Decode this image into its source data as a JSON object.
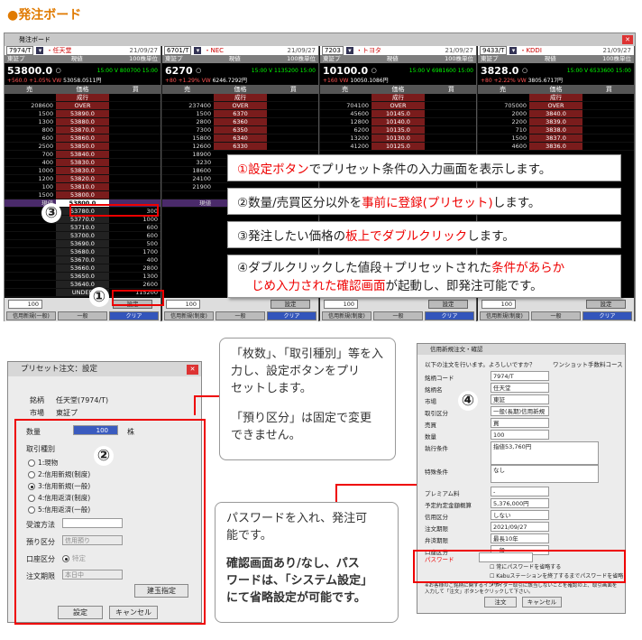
{
  "title": "●発注ボード",
  "board": {
    "window_title": "発注ボード",
    "panels": [
      {
        "code": "7974/T",
        "name": "・任天堂",
        "date": "21/09/27",
        "market": "東証プ",
        "mode": "現値",
        "unit": "100株単位",
        "price": "53800.0",
        "price_suffix": "○",
        "time": "15:00",
        "flag": "V",
        "vol": "800700",
        "t2": "15:00",
        "diff": "+560.0",
        "pct": "+1.05%",
        "vwap": "VW",
        "vwap_val": "53058.0511",
        "yen": "円",
        "cols": [
          "売",
          "価格",
          "買"
        ],
        "rows": [
          {
            "s": "",
            "p": "成行",
            "b": ""
          },
          {
            "s": "208600",
            "p": "OVER",
            "b": ""
          },
          {
            "s": "1500",
            "p": "53890.0",
            "b": ""
          },
          {
            "s": "1300",
            "p": "53880.0",
            "b": ""
          },
          {
            "s": "800",
            "p": "53870.0",
            "b": ""
          },
          {
            "s": "600",
            "p": "53860.0",
            "b": ""
          },
          {
            "s": "2500",
            "p": "53850.0",
            "b": ""
          },
          {
            "s": "700",
            "p": "53840.0",
            "b": ""
          },
          {
            "s": "400",
            "p": "53830.0",
            "b": ""
          },
          {
            "s": "1000",
            "p": "53830.0",
            "b": ""
          },
          {
            "s": "1200",
            "p": "53820.0",
            "b": ""
          },
          {
            "s": "100",
            "p": "53810.0",
            "b": ""
          },
          {
            "s": "1500",
            "p": "53800.0",
            "b": ""
          },
          {
            "s": "現値",
            "p": "53800.0",
            "b": "",
            "cur": true
          },
          {
            "s": "",
            "p": "53780.0",
            "b": "300"
          },
          {
            "s": "",
            "p": "53770.0",
            "b": "1000"
          },
          {
            "s": "",
            "p": "53710.0",
            "b": "600"
          },
          {
            "s": "",
            "p": "53700.0",
            "b": "600"
          },
          {
            "s": "",
            "p": "53690.0",
            "b": "500"
          },
          {
            "s": "",
            "p": "53680.0",
            "b": "1700"
          },
          {
            "s": "",
            "p": "53670.0",
            "b": "400"
          },
          {
            "s": "",
            "p": "53660.0",
            "b": "2800"
          },
          {
            "s": "",
            "p": "53650.0",
            "b": "1300"
          },
          {
            "s": "",
            "p": "53640.0",
            "b": "2600"
          },
          {
            "s": "",
            "p": "UNDER",
            "b": "115200"
          }
        ],
        "qty": "100",
        "set": "設定",
        "buttons": [
          "信用新規(一般)",
          "一般",
          "クリア"
        ]
      },
      {
        "code": "6701/T",
        "name": "・NEC",
        "date": "21/09/27",
        "market": "東証プ",
        "mode": "現値",
        "unit": "100株単位",
        "price": "6270",
        "price_suffix": "○",
        "time": "15:00",
        "flag": "V",
        "vol": "1135200",
        "t2": "15:00",
        "diff": "+80",
        "pct": "+1.29%",
        "vwap": "VW",
        "vwap_val": "6246.7292",
        "yen": "円",
        "cols": [
          "売",
          "価格",
          "買"
        ],
        "rows": [
          {
            "s": "",
            "p": "成行",
            "b": ""
          },
          {
            "s": "237400",
            "p": "OVER",
            "b": ""
          },
          {
            "s": "1500",
            "p": "6370",
            "b": ""
          },
          {
            "s": "2800",
            "p": "6360",
            "b": ""
          },
          {
            "s": "7300",
            "p": "6350",
            "b": ""
          },
          {
            "s": "15800",
            "p": "6340",
            "b": ""
          },
          {
            "s": "12600",
            "p": "6330",
            "b": ""
          },
          {
            "s": "18900",
            "p": "",
            "b": ""
          },
          {
            "s": "3230",
            "p": "",
            "b": ""
          },
          {
            "s": "18600",
            "p": "",
            "b": ""
          },
          {
            "s": "24100",
            "p": "",
            "b": ""
          },
          {
            "s": "21900",
            "p": "",
            "b": ""
          },
          {
            "s": "",
            "p": "",
            "b": ""
          },
          {
            "s": "現値",
            "p": "",
            "b": "",
            "cur": true
          }
        ],
        "qty": "100",
        "set": "設定",
        "buttons": [
          "信用新規(制度)",
          "一般",
          "クリア"
        ]
      },
      {
        "code": "7203",
        "name": "・トヨタ",
        "date": "21/09/27",
        "market": "東証プ",
        "mode": "現値",
        "unit": "100株単位",
        "price": "10100.0",
        "price_suffix": "○",
        "time": "15:00",
        "flag": "V",
        "vol": "6981600",
        "t2": "15:00",
        "diff": "+160",
        "pct": "",
        "vwap": "VW",
        "vwap_val": "10050.1086",
        "yen": "円",
        "cols": [
          "売",
          "価格",
          "買"
        ],
        "rows": [
          {
            "s": "",
            "p": "成行",
            "b": ""
          },
          {
            "s": "704100",
            "p": "OVER",
            "b": ""
          },
          {
            "s": "45600",
            "p": "10145.0",
            "b": ""
          },
          {
            "s": "12800",
            "p": "10140.0",
            "b": ""
          },
          {
            "s": "6200",
            "p": "10135.0",
            "b": ""
          },
          {
            "s": "13200",
            "p": "10130.0",
            "b": ""
          },
          {
            "s": "41200",
            "p": "10125.0",
            "b": ""
          }
        ],
        "qty": "100",
        "set": "設定",
        "buttons": [
          "信用新規(制度)",
          "一般",
          "クリア"
        ]
      },
      {
        "code": "9433/T",
        "name": "・KDDI",
        "date": "21/09/27",
        "market": "東証プ",
        "mode": "現値",
        "unit": "100株単位",
        "price": "3828.0",
        "price_suffix": "○",
        "time": "15:00",
        "flag": "V",
        "vol": "6533600",
        "t2": "15:00",
        "diff": "+80",
        "pct": "+2.22%",
        "vwap": "VW",
        "vwap_val": "3805.6717",
        "yen": "円",
        "cols": [
          "売",
          "価格",
          "買"
        ],
        "rows": [
          {
            "s": "",
            "p": "成行",
            "b": ""
          },
          {
            "s": "705000",
            "p": "OVER",
            "b": ""
          },
          {
            "s": "2000",
            "p": "3840.0",
            "b": ""
          },
          {
            "s": "2200",
            "p": "3839.0",
            "b": ""
          },
          {
            "s": "710",
            "p": "3838.0",
            "b": ""
          },
          {
            "s": "1500",
            "p": "3837.0",
            "b": ""
          },
          {
            "s": "4600",
            "p": "3836.0",
            "b": ""
          }
        ],
        "qty": "100",
        "set": "設定",
        "buttons": [
          "信用新規(制度)",
          "一般",
          "クリア"
        ]
      }
    ]
  },
  "callouts": [
    {
      "pre": "①",
      "red": "設定ボタン",
      "post": "でプリセット条件の入力画面を表示します。"
    },
    {
      "pre": "②数量/売買区分以外を",
      "red": "事前に登録(プリセット)",
      "post": "します。"
    },
    {
      "pre": "③発注したい価格の",
      "red": "板上でダブルクリック",
      "post": "します。"
    },
    {
      "pre": "④ダブルクリックした値段＋プリセットされた",
      "red": "条件があらか",
      "line2_red": "じめ入力された確認画面",
      "line2_post": "が起動し、即発注可能です。"
    }
  ],
  "nums": {
    "n1": "①",
    "n2": "②",
    "n3": "③",
    "n4": "④"
  },
  "preset": {
    "title": "プリセット注文：設定",
    "label_code": "銘柄",
    "code_val": "任天堂(7974/T)",
    "label_market": "市場",
    "market_val": "東証プ",
    "label_qty": "数量",
    "qty_val": "100",
    "qty_unit": "株",
    "label_type": "取引種別",
    "radios": [
      "1:現物",
      "2:信用新規(制度)",
      "3:信用新規(一般)",
      "4:信用返済(制度)",
      "5:信用返済(一般)"
    ],
    "label_method": "受渡方法",
    "label_deposit": "預り区分",
    "deposit_val": "信用預り",
    "label_account": "口座区分",
    "account_val": "特定",
    "label_period": "注文期限",
    "period_val": "本日中",
    "btn_settle": "建玉指定",
    "btn_set": "設定",
    "btn_cancel": "キャンセル"
  },
  "note1": {
    "l1": "「枚数」、「取引種別」等を入",
    "l2": "力し、設定ボタンをプリ",
    "l3": "セットします。",
    "l4": "「預り区分」は固定で変更",
    "l5": "できません。"
  },
  "note2": {
    "l1": "パスワードを入れ、発注可",
    "l2": "能です。",
    "l3": "確認画面あり/なし、パス",
    "l4": "ワードは、「システム設定」",
    "l5": "にて省略設定が可能です。"
  },
  "confirm": {
    "title": "信用新規注文・確認",
    "msg": "以下の注文を行います。よろしいですか？",
    "brand": "ワンショット手数料コース",
    "fields": [
      {
        "k": "銘柄コード",
        "v": "7974/T"
      },
      {
        "k": "銘柄名",
        "v": "任天堂"
      },
      {
        "k": "市場",
        "v": "東証"
      },
      {
        "k": "取引区分",
        "v": "一般(長期)信用新規"
      },
      {
        "k": "売買",
        "v": "買"
      },
      {
        "k": "数量",
        "v": "100"
      },
      {
        "k": "執行条件",
        "v": "指値53,760円"
      }
    ],
    "label_special": "特殊条件",
    "special_val": "なし",
    "fields2": [
      {
        "k": "プレミアム料",
        "v": "-"
      },
      {
        "k": "予定約定金額概算",
        "v": "5,376,000円"
      },
      {
        "k": "信用区分",
        "v": "しない"
      },
      {
        "k": "注文期限",
        "v": "2021/09/27"
      },
      {
        "k": "弁済期限",
        "v": "最長10年"
      },
      {
        "k": "口座区分",
        "v": "一般"
      }
    ],
    "label_pw": "パスワード",
    "chk1": "常にパスワードを省略する",
    "chk2": "Kabuステーションを終了するまでパスワードを省略する",
    "foot": "※お客様のご銘柄に関するインサイダー取引に該当しないことを確認の上、取引画面を入力して「注文」ボタンをクリックして下さい。",
    "btn_order": "注文",
    "btn_cancel": "キャンセル"
  }
}
